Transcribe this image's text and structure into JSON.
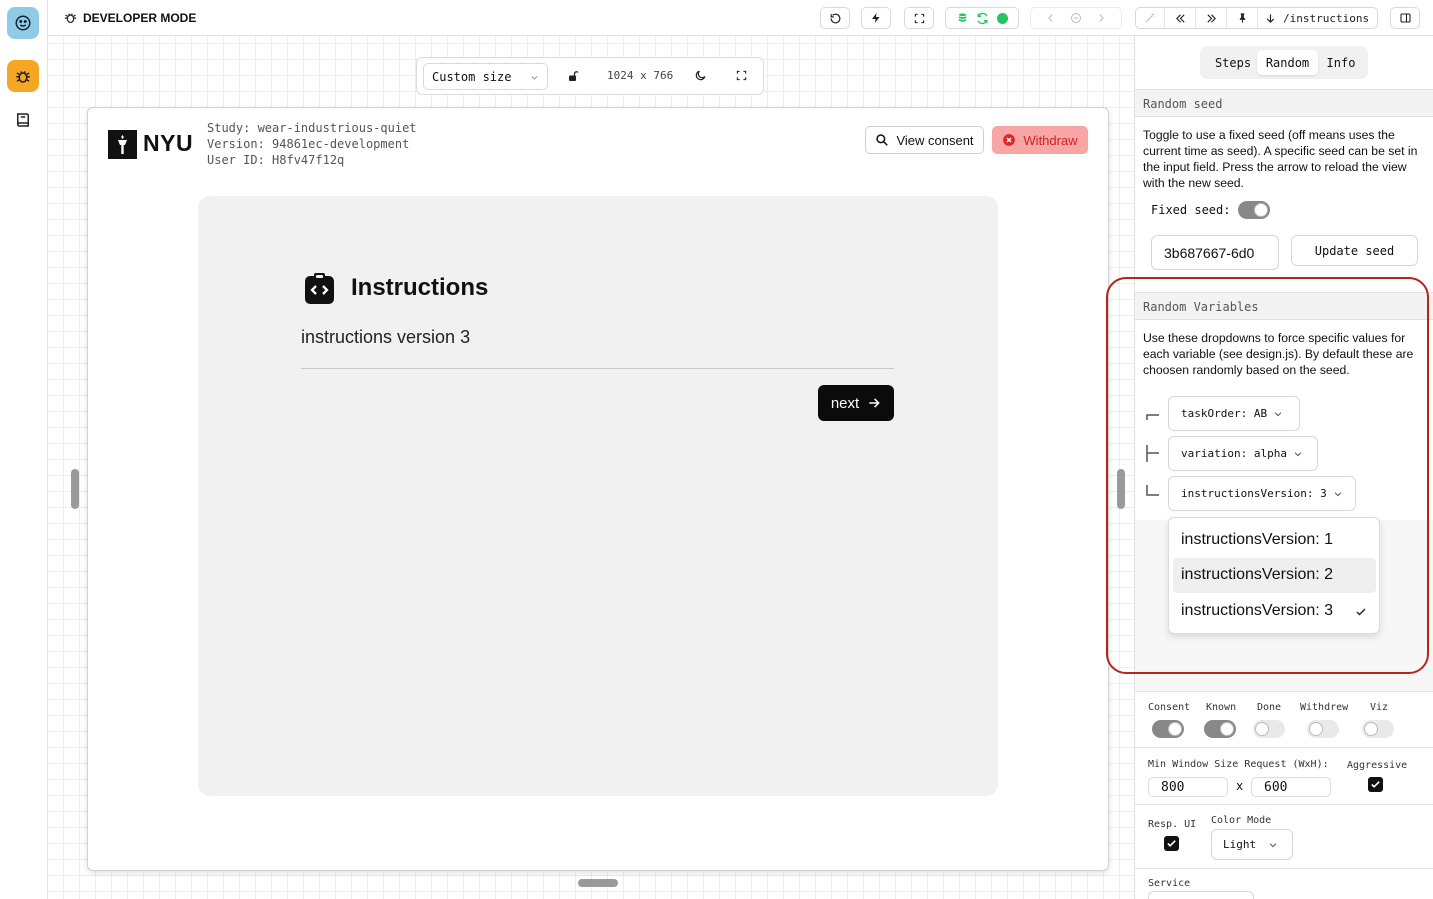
{
  "topbar": {
    "mode_label": "DEVELOPER MODE",
    "route": "/instructions"
  },
  "viewport": {
    "size_select": "Custom size",
    "dimensions": "1024 x 766"
  },
  "study": {
    "logo_text": "NYU",
    "study_line": "Study: wear-industrious-quiet",
    "version_line": "Version: 94861ec-development",
    "user_line": "User ID: H8fv47f12q",
    "view_consent_label": "View consent",
    "withdraw_label": "Withdraw"
  },
  "page": {
    "heading": "Instructions",
    "body": "instructions version 3",
    "next_label": "next"
  },
  "panel": {
    "tabs": [
      "Steps",
      "Random",
      "Info"
    ],
    "active_tab": "Random",
    "seed": {
      "header": "Random seed",
      "description": "Toggle to use a fixed seed (off means uses the current time as seed). A specific seed can be set in the input field. Press the arrow to reload the view with the new seed.",
      "fixed_label": "Fixed seed:",
      "value": "3b687667-6d0",
      "update_label": "Update seed"
    },
    "vars": {
      "header": "Random Variables",
      "description": "Use these dropdowns to force specific values for each variable (see design.js). By default these are choosen randomly based on the seed.",
      "items": [
        "taskOrder: AB",
        "variation: alpha",
        "instructionsVersion: 3"
      ],
      "menu_options": [
        "instructionsVersion: 1",
        "instructionsVersion: 2",
        "instructionsVersion: 3"
      ],
      "menu_selected": "instructionsVersion: 3"
    },
    "flags": {
      "labels": [
        "Consent",
        "Known",
        "Done",
        "Withdrew",
        "Viz"
      ],
      "states": [
        true,
        true,
        false,
        false,
        false
      ]
    },
    "window": {
      "label": "Min Window Size Request (WxH):",
      "width": "800",
      "x": "x",
      "height": "600",
      "aggressive_label": "Aggressive"
    },
    "resp_ui_label": "Resp. UI",
    "color_mode_label": "Color Mode",
    "color_mode_value": "Light",
    "service_label": "Service"
  },
  "colors": {
    "accent_orange": "#f5a623",
    "accent_blue": "#8ecae6",
    "withdraw_bg": "#f8a5a5",
    "withdraw_icon": "#e02424",
    "annotation_red": "#b3261e",
    "status_green": "#22c55e"
  }
}
